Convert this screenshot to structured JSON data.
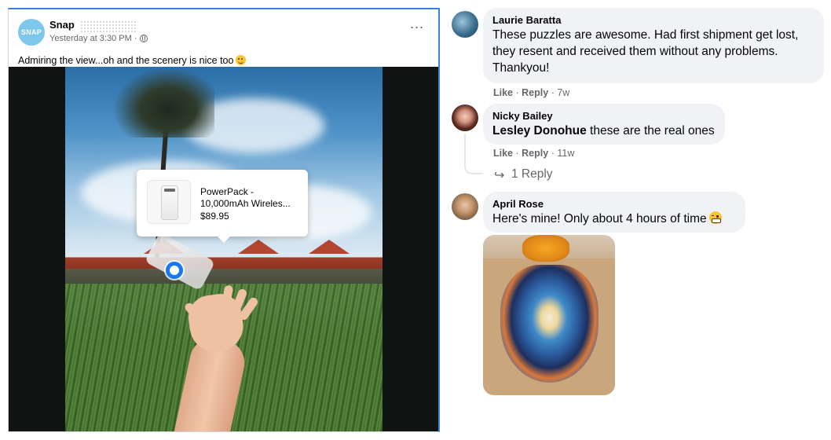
{
  "post": {
    "page_name": "Snap",
    "avatar_text": "SNAP",
    "timestamp": "Yesterday at 3:30 PM · ",
    "text": "Admiring the view...oh and the scenery is nice too",
    "more_icon": "⋯"
  },
  "product_tag": {
    "name": "PowerPack - 10,000mAh Wireles...",
    "price": "$89.95"
  },
  "comments": [
    {
      "author": "Laurie Baratta",
      "text": "These puzzles are awesome. Had first shipment get lost, they resent and received them without any problems. Thankyou!",
      "like": "Like",
      "reply": "Reply",
      "time": "7w"
    },
    {
      "author": "Nicky Bailey",
      "mention": "Lesley Donohue",
      "text": " these are the real ones",
      "like": "Like",
      "reply": "Reply",
      "time": "11w",
      "replies_label": "1 Reply"
    },
    {
      "author": "April Rose",
      "text": "Here's mine! Only about 4 hours of time"
    }
  ],
  "colors": {
    "accent": "#1877f2",
    "bubble": "#f0f2f5",
    "secondary_text": "#65676b"
  }
}
